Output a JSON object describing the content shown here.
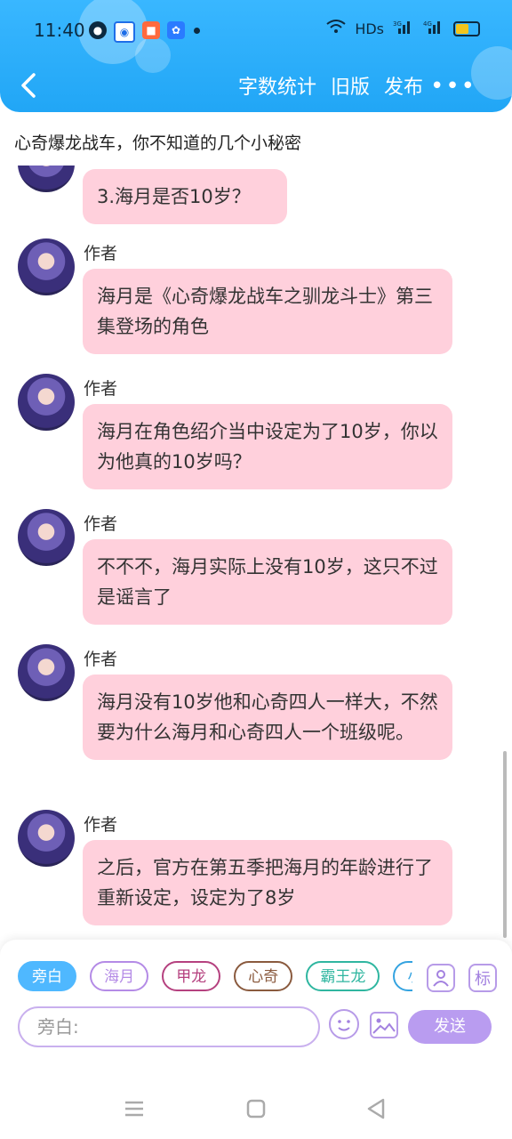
{
  "status": {
    "time": "11:40",
    "network": "HDs"
  },
  "header": {
    "actions": [
      "字数统计",
      "旧版",
      "发布"
    ],
    "more": "•••"
  },
  "title": "心奇爆龙战车，你不知道的几个小秘密",
  "messages": [
    {
      "name": "",
      "text": "3.海月是否10岁？"
    },
    {
      "name": "作者",
      "text": "海月是《心奇爆龙战车之驯龙斗士》第三集登场的角色"
    },
    {
      "name": "作者",
      "text": "海月在角色绍介当中设定为了10岁，你以为他真的10岁吗？"
    },
    {
      "name": "作者",
      "text": "不不不，海月实际上没有10岁，这只不过是谣言了"
    },
    {
      "name": "作者",
      "text": "海月没有10岁他和心奇四人一样大，不然要为什么海月和心奇四人一个班级呢。"
    },
    {
      "name": "作者",
      "text": "之后，官方在第五季把海月的年龄进行了重新设定，设定为了8岁"
    }
  ],
  "composer": {
    "chips": [
      "旁白",
      "海月",
      "甲龙",
      "心奇",
      "霸王龙",
      "小"
    ],
    "chip_colors": [
      "#4fb8ff",
      "#b48be6",
      "#b5417f",
      "#8a5a3e",
      "#2fb6a0",
      "#34a3e0"
    ],
    "mark_label": "标",
    "input_placeholder": "旁白:",
    "send_label": "发送"
  }
}
